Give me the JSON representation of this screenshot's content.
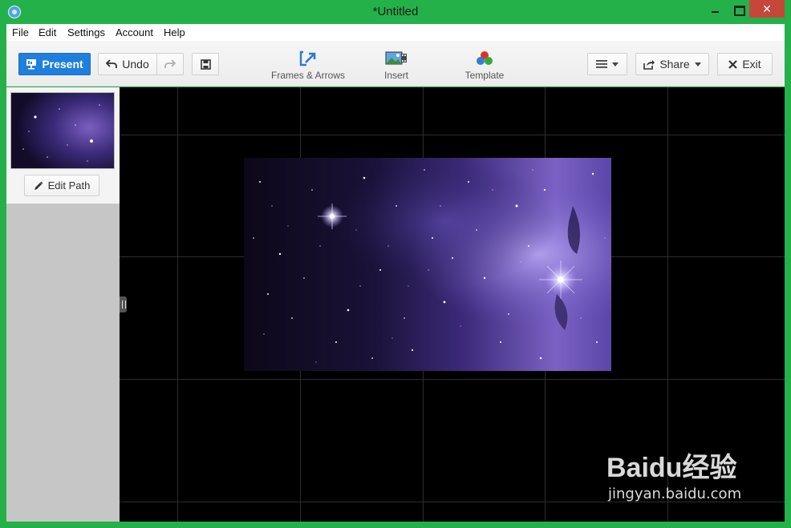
{
  "window": {
    "title": "*Untitled",
    "close_glyph": "✕",
    "accent": "#24b14a"
  },
  "menubar": {
    "items": [
      "File",
      "Edit",
      "Settings",
      "Account",
      "Help"
    ]
  },
  "toolbar": {
    "present_label": "Present",
    "undo_label": "Undo",
    "frames_label": "Frames & Arrows",
    "insert_label": "Insert",
    "template_label": "Template",
    "share_label": "Share",
    "exit_label": "Exit",
    "present_color": "#1e7fde"
  },
  "sidebar": {
    "edit_path_label": "Edit Path"
  },
  "watermark": {
    "logo": "Baidu经验",
    "url": "jingyan.baidu.com"
  }
}
